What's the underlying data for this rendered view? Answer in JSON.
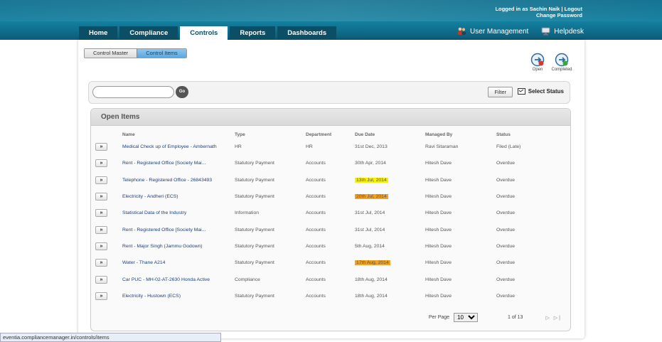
{
  "header": {
    "logged_in_text": "Logged in as Sachin Naik",
    "separator": "|",
    "logout": "Logout",
    "change_password": "Change Password"
  },
  "nav": {
    "tabs": [
      {
        "label": "Home"
      },
      {
        "label": "Compliance"
      },
      {
        "label": "Controls"
      },
      {
        "label": "Reports"
      },
      {
        "label": "Dashboards"
      }
    ],
    "active_tab": "Controls",
    "user_management": "User Management",
    "helpdesk": "Helpdesk"
  },
  "subtabs": {
    "control_master": "Control Master",
    "control_items": "Control Items"
  },
  "actions": {
    "open": "Open",
    "completed": "Completed"
  },
  "search": {
    "value": "",
    "go": "Go",
    "filter": "Filter",
    "select_status": "Select Status"
  },
  "open_items": {
    "title": "Open Items",
    "columns": [
      "Name",
      "Type",
      "Department",
      "Due Date",
      "Managed By",
      "Status"
    ],
    "rows": [
      {
        "name": "Medical Check up of Employee - Ambernath",
        "type": "HR",
        "department": "HR",
        "due_date": "31st Dec, 2013",
        "managed_by": "Ravi Sitaraman",
        "status": "Filed (Late)",
        "highlight": ""
      },
      {
        "name": "Rent - Registered Office [Society Mai...",
        "type": "Statutory Payment",
        "department": "Accounts",
        "due_date": "30th Apr, 2014",
        "managed_by": "Hitesh Dave",
        "status": "Overdue",
        "highlight": ""
      },
      {
        "name": "Telephone - Registered Office - 26843493",
        "type": "Statutory Payment",
        "department": "Accounts",
        "due_date": "13th Jul, 2014",
        "managed_by": "Hitesh Dave",
        "status": "Overdue",
        "highlight": "yellow"
      },
      {
        "name": "Electricity - Andheri (ECS)",
        "type": "Statutory Payment",
        "department": "Accounts",
        "due_date": "20th Jul, 2014",
        "managed_by": "Hitesh Dave",
        "status": "Overdue",
        "highlight": "orange"
      },
      {
        "name": "Statistical Data of the Industry",
        "type": "Information",
        "department": "Accounts",
        "due_date": "31st Jul, 2014",
        "managed_by": "Hitesh Dave",
        "status": "Overdue",
        "highlight": ""
      },
      {
        "name": "Rent - Registered Office [Society Mai...",
        "type": "Statutory Payment",
        "department": "Accounts",
        "due_date": "31st Jul, 2014",
        "managed_by": "Hitesh Dave",
        "status": "Overdue",
        "highlight": ""
      },
      {
        "name": "Rent - Major Singh (Jammu Godown)",
        "type": "Statutory Payment",
        "department": "Accounts",
        "due_date": "5th Aug, 2014",
        "managed_by": "Hitesh Dave",
        "status": "Overdue",
        "highlight": ""
      },
      {
        "name": "Water - Thane A214",
        "type": "Statutory Payment",
        "department": "Accounts",
        "due_date": "17th Aug, 2014",
        "managed_by": "Hitesh Dave",
        "status": "Overdue",
        "highlight": "orange"
      },
      {
        "name": "Car PUC - MH-02-AT-2630 Honda Active",
        "type": "Compliance",
        "department": "Accounts",
        "due_date": "18th Aug, 2014",
        "managed_by": "Hitesh Dave",
        "status": "Overdue",
        "highlight": ""
      },
      {
        "name": "Electricity - Hustown (ECS)",
        "type": "Statutory Payment",
        "department": "Accounts",
        "due_date": "18th Aug, 2014",
        "managed_by": "Hitesh Dave",
        "status": "Overdue",
        "highlight": ""
      }
    ]
  },
  "pager": {
    "per_page_label": "Per Page",
    "per_page_value": "10",
    "page_info": "1 of 13"
  },
  "statusbar": {
    "url": "eventia.compliancemanager.in/controls/items"
  },
  "colors": {
    "banner": "#0e6f8e",
    "nav_tab": "#0b4f66",
    "highlight_yellow": "#f7f000",
    "highlight_orange": "#f3a11e",
    "link": "#1f3f7a"
  }
}
